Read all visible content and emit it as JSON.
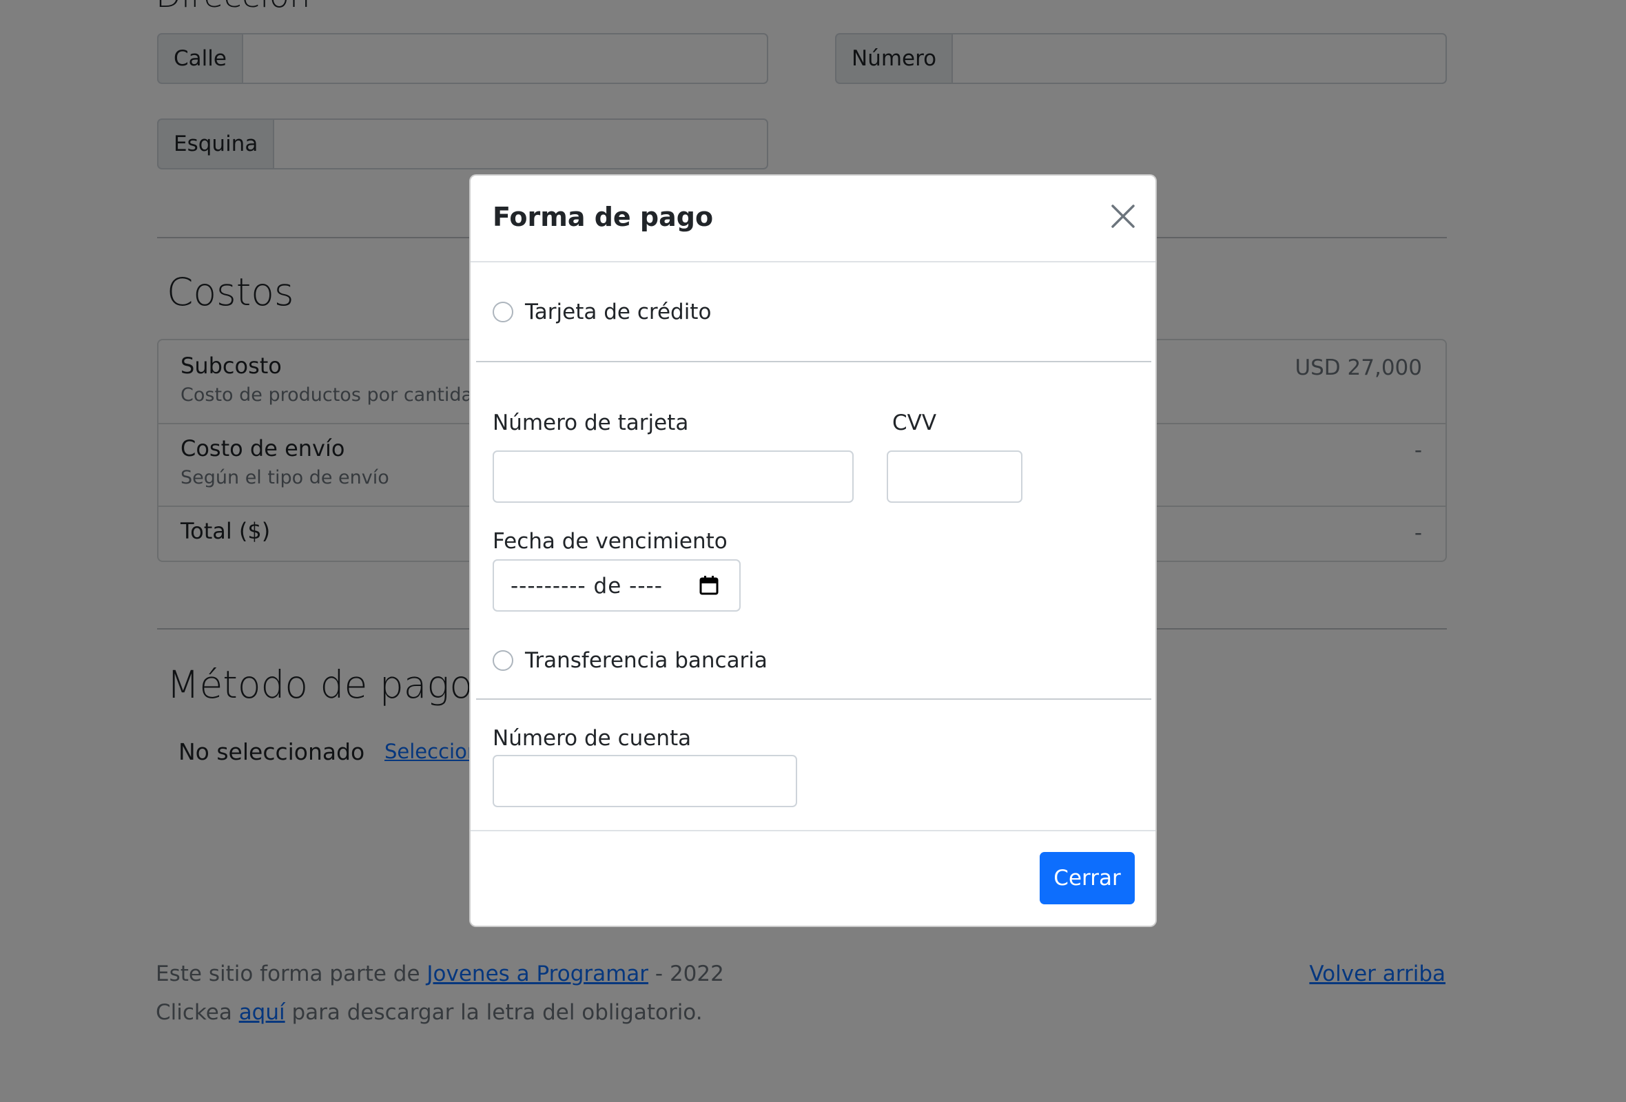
{
  "address": {
    "section_title": "Dirección",
    "street_label": "Calle",
    "number_label": "Número",
    "corner_label": "Esquina"
  },
  "costs": {
    "title": "Costos",
    "rows": [
      {
        "name": "Subcosto",
        "sub": "Costo de productos por cantidad",
        "value": "USD 27,000"
      },
      {
        "name": "Costo de envío",
        "sub": "Según el tipo de envío",
        "value": "-"
      },
      {
        "name": "Total ($)",
        "sub": "",
        "value": "-"
      }
    ]
  },
  "payment_method": {
    "title": "Método de pago",
    "status": "No seleccionado",
    "select_link": "Seleccionar"
  },
  "footer": {
    "line1_prefix": "Este sitio forma parte de ",
    "line1_link": "Jovenes a Programar",
    "line1_suffix": " - 2022",
    "line2_prefix": "Clickea ",
    "line2_link": "aquí",
    "line2_suffix": " para descargar la letra del obligatorio.",
    "back_to_top": "Volver arriba"
  },
  "modal": {
    "title": "Forma de pago",
    "credit_card_option": "Tarjeta de crédito",
    "card_number_label": "Número de tarjeta",
    "cvv_label": "CVV",
    "expiry_label": "Fecha de vencimiento",
    "expiry_placeholder": "--------- de ----",
    "bank_transfer_option": "Transferencia bancaria",
    "account_number_label": "Número de cuenta",
    "close_button": "Cerrar"
  },
  "colors": {
    "primary": "#0d6efd",
    "backdrop": "rgba(0,0,0,0.5)",
    "muted_text": "#6c757d"
  }
}
